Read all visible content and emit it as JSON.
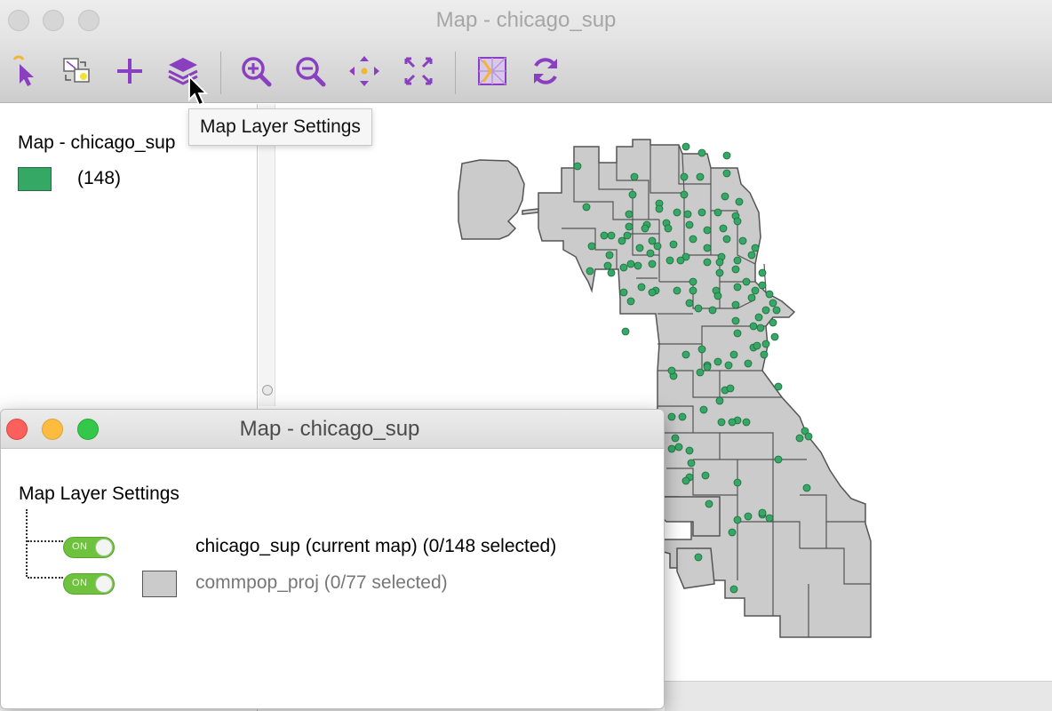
{
  "main_window": {
    "title": "Map - chicago_sup"
  },
  "toolbar": {
    "tools": [
      {
        "name": "select-tool",
        "icon": "pointer-arrow-icon"
      },
      {
        "name": "selection-shape-tool",
        "icon": "selection-shape-icon"
      },
      {
        "name": "add-layer-tool",
        "icon": "plus-icon"
      },
      {
        "name": "map-layer-settings-tool",
        "icon": "layers-icon"
      },
      {
        "name": "zoom-in-tool",
        "icon": "zoom-in-icon"
      },
      {
        "name": "zoom-out-tool",
        "icon": "zoom-out-icon"
      },
      {
        "name": "pan-tool",
        "icon": "pan-arrows-icon"
      },
      {
        "name": "full-extent-tool",
        "icon": "full-extent-icon"
      },
      {
        "name": "basemap-tool",
        "icon": "basemap-icon"
      },
      {
        "name": "refresh-tool",
        "icon": "refresh-icon"
      }
    ],
    "accent_color": "#8a3fc0"
  },
  "tooltip": {
    "text": "Map Layer Settings"
  },
  "legend": {
    "title": "Map - chicago_sup",
    "items": [
      {
        "color": "#35a865",
        "count": "(148)"
      }
    ]
  },
  "map": {
    "area_fill": "#cbcbcb",
    "area_stroke": "#555555",
    "point_fill": "#35a865",
    "point_stroke": "#1f6b3d"
  },
  "dialog": {
    "title": "Map - chicago_sup",
    "heading": "Map Layer Settings",
    "layers": [
      {
        "toggle": "ON",
        "name": "chicago_sup (current map) (0/148 selected)",
        "swatch": null
      },
      {
        "toggle": "ON",
        "name": "commpop_proj (0/77 selected)",
        "swatch": "#cbcbcb"
      }
    ]
  }
}
